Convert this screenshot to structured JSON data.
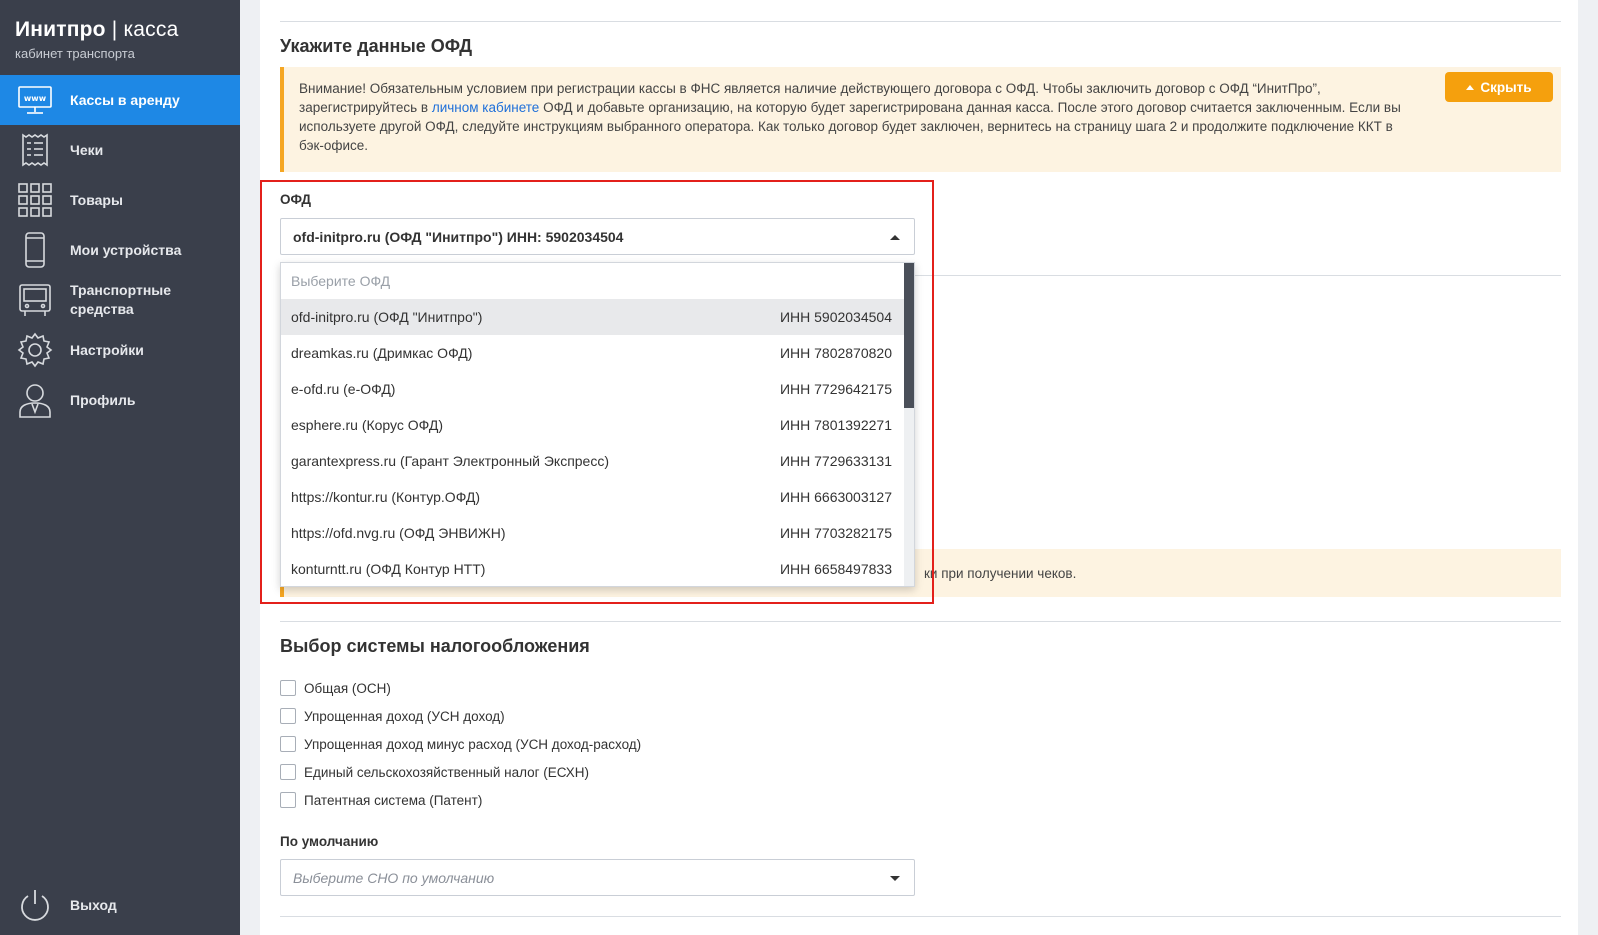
{
  "brand": {
    "title_bold": "Инитпро",
    "title_sep": " | ",
    "title_thin": "касса",
    "subtitle": "кабинет транспорта"
  },
  "sidebar": {
    "items": [
      {
        "label": "Кассы в аренду",
        "icon": "www-monitor-icon",
        "active": true
      },
      {
        "label": "Чеки",
        "icon": "receipt-icon"
      },
      {
        "label": "Товары",
        "icon": "grid-icon"
      },
      {
        "label": "Мои устройства",
        "icon": "phone-icon"
      },
      {
        "label": "Транспортные средства",
        "icon": "bus-icon"
      },
      {
        "label": "Настройки",
        "icon": "gear-icon"
      },
      {
        "label": "Профиль",
        "icon": "user-icon"
      }
    ],
    "logout": "Выход"
  },
  "ofd_section": {
    "title": "Укажите данные ОФД",
    "notice_part1": "Внимание! Обязательным условием при регистрации кассы в ФНС является наличие действующего договора с ОФД. Чтобы заключить договор с ОФД “ИнитПро”, зарегистрируйтесь в ",
    "notice_link": "личном кабинете",
    "notice_part2": " ОФД и добавьте организацию, на которую будет зарегистрирована данная касса. После этого договор считается заключенным. Если вы используете другой ОФД, следуйте инструкциям выбранного оператора. Как только договор будет заключен, вернитесь на страницу шага 2 и продолжите подключение ККТ в бэк-офисе.",
    "hide_button": "Скрыть",
    "field_label": "ОФД",
    "selected_value": "ofd-initpro.ru (ОФД \"Инитпро\") ИНН: 5902034504",
    "dropdown_placeholder": "Выберите ОФД",
    "options": [
      {
        "name": "ofd-initpro.ru (ОФД \"Инитпро\")",
        "inn": "ИНН 5902034504"
      },
      {
        "name": "dreamkas.ru (Дримкас ОФД)",
        "inn": "ИНН 7802870820"
      },
      {
        "name": "e-ofd.ru (е-ОФД)",
        "inn": "ИНН 7729642175"
      },
      {
        "name": "esphere.ru (Корус ОФД)",
        "inn": "ИНН 7801392271"
      },
      {
        "name": "garantexpress.ru (Гарант Электронный Экспресс)",
        "inn": "ИНН 7729633131"
      },
      {
        "name": "https://kontur.ru (Контур.ОФД)",
        "inn": "ИНН 6663003127"
      },
      {
        "name": "https://ofd.nvg.ru (ОФД ЭНВИЖН)",
        "inn": "ИНН 7703282175"
      },
      {
        "name": "konturntt.ru (ОФД Контур НТТ)",
        "inn": "ИНН 6658497833"
      }
    ],
    "notice2_tail": "ки при получении чеков."
  },
  "tax_section": {
    "title": "Выбор системы налогообложения",
    "options": [
      "Общая (ОСН)",
      "Упрощенная доход (УСН доход)",
      "Упрощенная доход минус расход (УСН доход-расход)",
      "Единый сельскохозяйственный налог (ЕСХН)",
      "Патентная система (Патент)"
    ],
    "default_label": "По умолчанию",
    "default_placeholder": "Выберите СНО по умолчанию"
  },
  "colors": {
    "sidebar_bg": "#3a3f4b",
    "active": "#1e88e5",
    "accent": "#f5a00d",
    "highlight": "#e3201b"
  }
}
